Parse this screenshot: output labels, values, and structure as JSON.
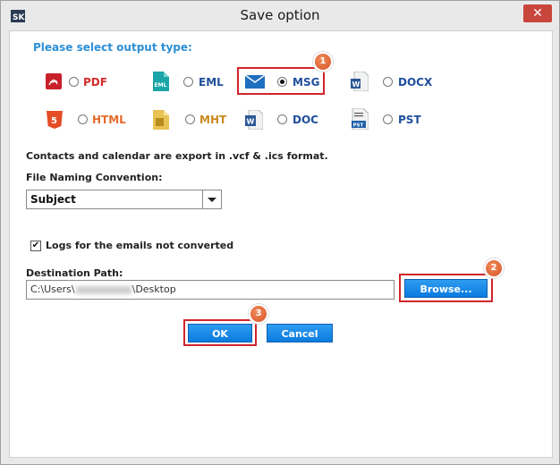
{
  "window": {
    "title": "Save option",
    "close_glyph": "✕",
    "app_icon": "sk-logo-icon"
  },
  "prompt": "Please select output type:",
  "options": [
    {
      "id": "pdf",
      "label": "PDF",
      "icon": "pdf-icon",
      "selected": false,
      "color": "#d42b2b"
    },
    {
      "id": "eml",
      "label": "EML",
      "icon": "eml-icon",
      "selected": false,
      "color": "#1f4e9c"
    },
    {
      "id": "msg",
      "label": "MSG",
      "icon": "envelope-icon",
      "selected": true,
      "color": "#1f4e9c"
    },
    {
      "id": "docx",
      "label": "DOCX",
      "icon": "word-icon",
      "selected": false,
      "color": "#1f4e9c"
    },
    {
      "id": "html",
      "label": "HTML",
      "icon": "html5-icon",
      "selected": false,
      "color": "#e56a2a"
    },
    {
      "id": "mht",
      "label": "MHT",
      "icon": "mht-icon",
      "selected": false,
      "color": "#c98a1f"
    },
    {
      "id": "doc",
      "label": "DOC",
      "icon": "word-icon",
      "selected": false,
      "color": "#1f4e9c"
    },
    {
      "id": "pst",
      "label": "PST",
      "icon": "pst-icon",
      "selected": false,
      "color": "#1f4e9c"
    }
  ],
  "note": "Contacts and calendar are export in .vcf & .ics format.",
  "file_naming": {
    "label": "File Naming Convention:",
    "value": "Subject"
  },
  "logs": {
    "checked": true,
    "check_glyph": "✔",
    "label": "Logs for the emails not converted"
  },
  "destination": {
    "label": "Destination Path:",
    "path_prefix": "C:\\Users\\",
    "path_suffix": "\\Desktop"
  },
  "buttons": {
    "browse": "Browse...",
    "ok": "OK",
    "cancel": "Cancel"
  },
  "steps": [
    "1",
    "2",
    "3"
  ],
  "colors": {
    "accent": "#2d8fd5",
    "highlight": "#d0252b",
    "button": "#0a7be0",
    "step_badge": "#e06a3a"
  }
}
